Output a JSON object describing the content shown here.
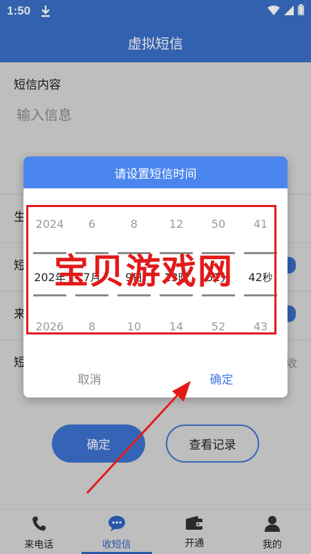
{
  "status": {
    "time": "1:50"
  },
  "app_title": "虚拟短信",
  "form": {
    "content_label": "短信内容",
    "content_placeholder": "输入信息",
    "row1_label": "生",
    "row2_label": "短",
    "row3_label": "来",
    "row4_label": "短",
    "row4_side": "收"
  },
  "buttons": {
    "confirm": "确定",
    "records": "查看记录"
  },
  "dialog": {
    "title": "请设置短信时间",
    "cancel": "取消",
    "ok": "确定",
    "columns": [
      {
        "prev": "2024",
        "sel": "202",
        "unit": "年",
        "next": "2026"
      },
      {
        "prev": "6",
        "sel": "7",
        "unit": "月",
        "next": "8"
      },
      {
        "prev": "8",
        "sel": "9",
        "unit": "日",
        "next": "10"
      },
      {
        "prev": "12",
        "sel": "13",
        "unit": "时",
        "next": "14"
      },
      {
        "prev": "50",
        "sel": "51",
        "unit": "分",
        "next": "52"
      },
      {
        "prev": "41",
        "sel": "42",
        "unit": "秒",
        "next": "43"
      }
    ]
  },
  "watermark": "宝贝游戏网",
  "nav": [
    {
      "label": "来电话",
      "icon": "phone-icon"
    },
    {
      "label": "收短信",
      "icon": "chat-icon"
    },
    {
      "label": "开通",
      "icon": "wallet-icon"
    },
    {
      "label": "我的",
      "icon": "person-icon"
    }
  ],
  "colors": {
    "primary": "#3a6fc8",
    "dialog_header": "#4a86ee",
    "watermark": "#e21a1a"
  }
}
